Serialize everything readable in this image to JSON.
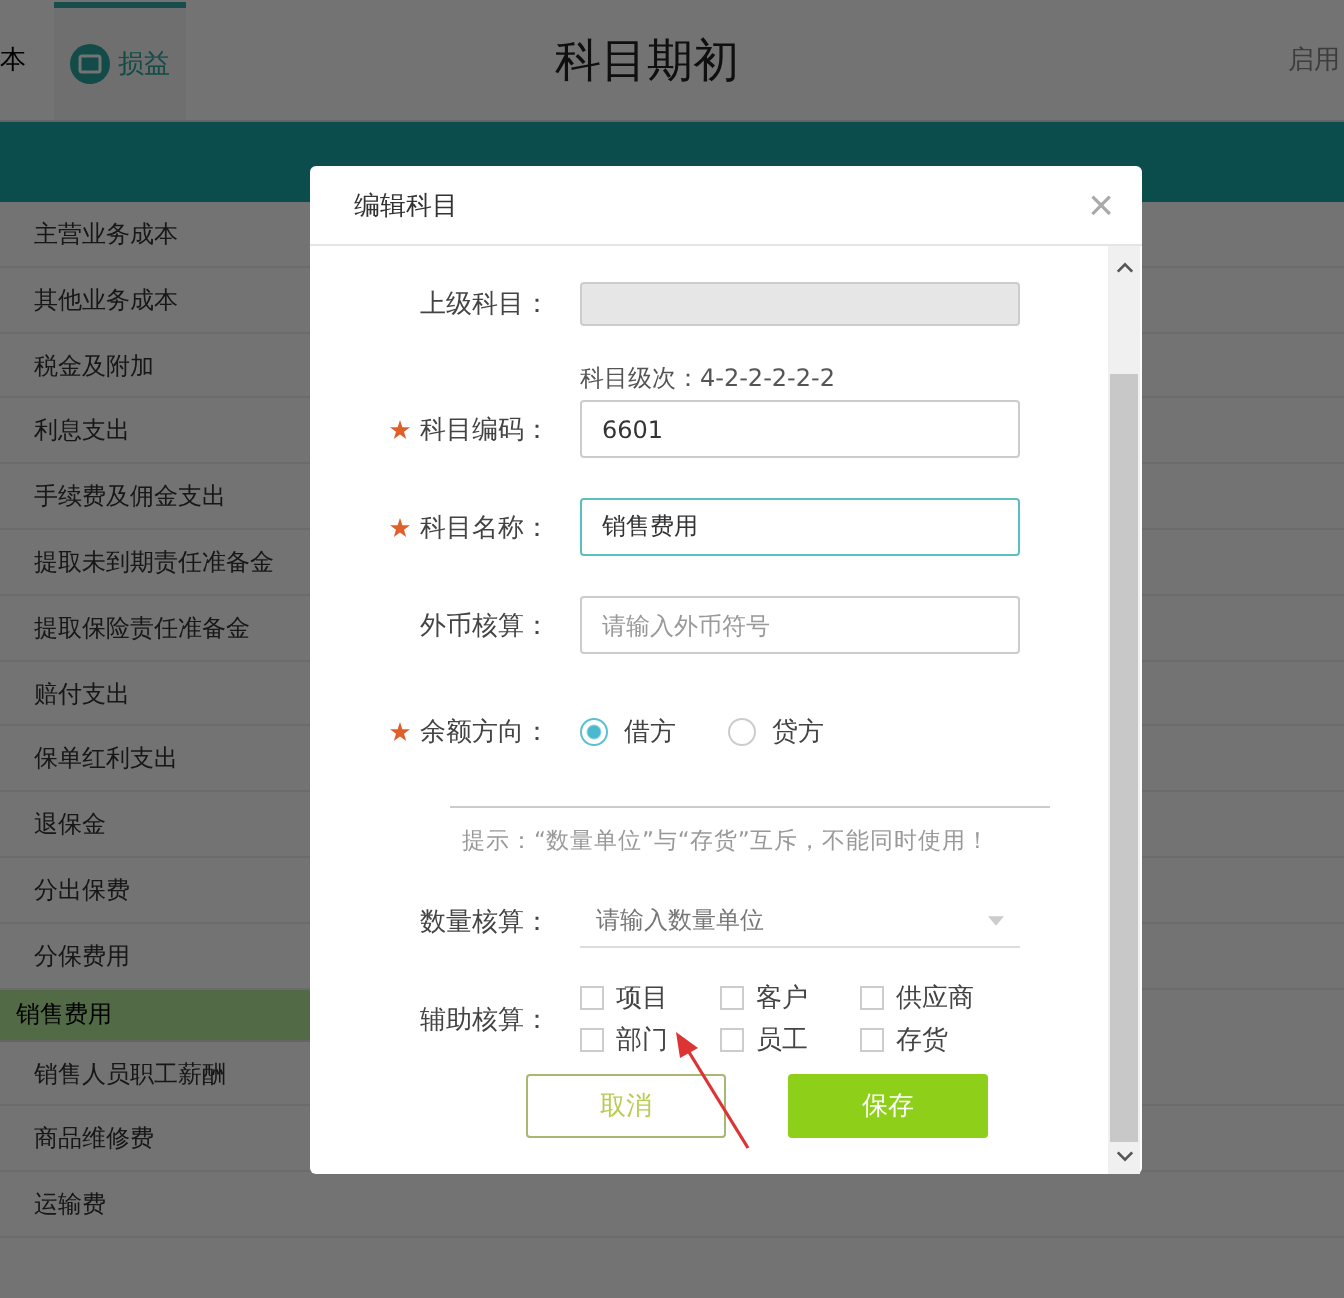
{
  "header": {
    "left_cut": "本",
    "tab": {
      "label": "损益",
      "selected": true
    },
    "title": "科目期初",
    "right_cut": "启用"
  },
  "list": [
    {
      "label": "主营业务成本",
      "selected": false
    },
    {
      "label": "其他业务成本",
      "selected": false
    },
    {
      "label": "税金及附加",
      "selected": false
    },
    {
      "label": "利息支出",
      "selected": false
    },
    {
      "label": "手续费及佣金支出",
      "selected": false
    },
    {
      "label": "提取未到期责任准备金",
      "selected": false
    },
    {
      "label": "提取保险责任准备金",
      "selected": false
    },
    {
      "label": "赔付支出",
      "selected": false
    },
    {
      "label": "保单红利支出",
      "selected": false
    },
    {
      "label": "退保金",
      "selected": false
    },
    {
      "label": "分出保费",
      "selected": false
    },
    {
      "label": "分保费用",
      "selected": false
    },
    {
      "label": "销售费用",
      "selected": true
    },
    {
      "label": "销售人员职工薪酬",
      "selected": false
    },
    {
      "label": "商品维修费",
      "selected": false
    },
    {
      "label": "运输费",
      "selected": false
    }
  ],
  "dialog": {
    "title": "编辑科目",
    "close": "×",
    "fields": [
      {
        "kind": "input",
        "label": "上级科目：",
        "required": false,
        "disabled": true,
        "focused": false
      },
      {
        "kind": "note",
        "text": "科目级次：4-2-2-2-2-2"
      },
      {
        "kind": "input",
        "label": "科目编码：",
        "required": true,
        "value": "6601",
        "disabled": false,
        "focused": false
      },
      {
        "kind": "input",
        "label": "科目名称：",
        "required": true,
        "value": "销售费用",
        "disabled": false,
        "focused": true
      },
      {
        "kind": "input",
        "label": "外币核算：",
        "required": false,
        "placeholder": "请输入外币符号",
        "disabled": false,
        "focused": false
      },
      {
        "kind": "radio",
        "label": "余额方向：",
        "required": true,
        "options": [
          {
            "label": "借方",
            "selected": true
          },
          {
            "label": "贷方",
            "selected": false
          }
        ]
      },
      {
        "kind": "hint",
        "text": "提示：“数量单位”与“存货”互斥，不能同时使用！"
      },
      {
        "kind": "select",
        "label": "数量核算：",
        "required": false,
        "placeholder": "请输入数量单位"
      },
      {
        "kind": "checks",
        "label": "辅助核算：",
        "required": false,
        "options": [
          {
            "label": "项目",
            "checked": false
          },
          {
            "label": "客户",
            "checked": false
          },
          {
            "label": "供应商",
            "checked": false
          },
          {
            "label": "部门",
            "checked": false
          },
          {
            "label": "员工",
            "checked": false
          },
          {
            "label": "存货",
            "checked": false
          }
        ]
      }
    ],
    "buttons": [
      {
        "kind": "cancel",
        "label": "取消"
      },
      {
        "kind": "save",
        "label": "保存"
      }
    ]
  }
}
